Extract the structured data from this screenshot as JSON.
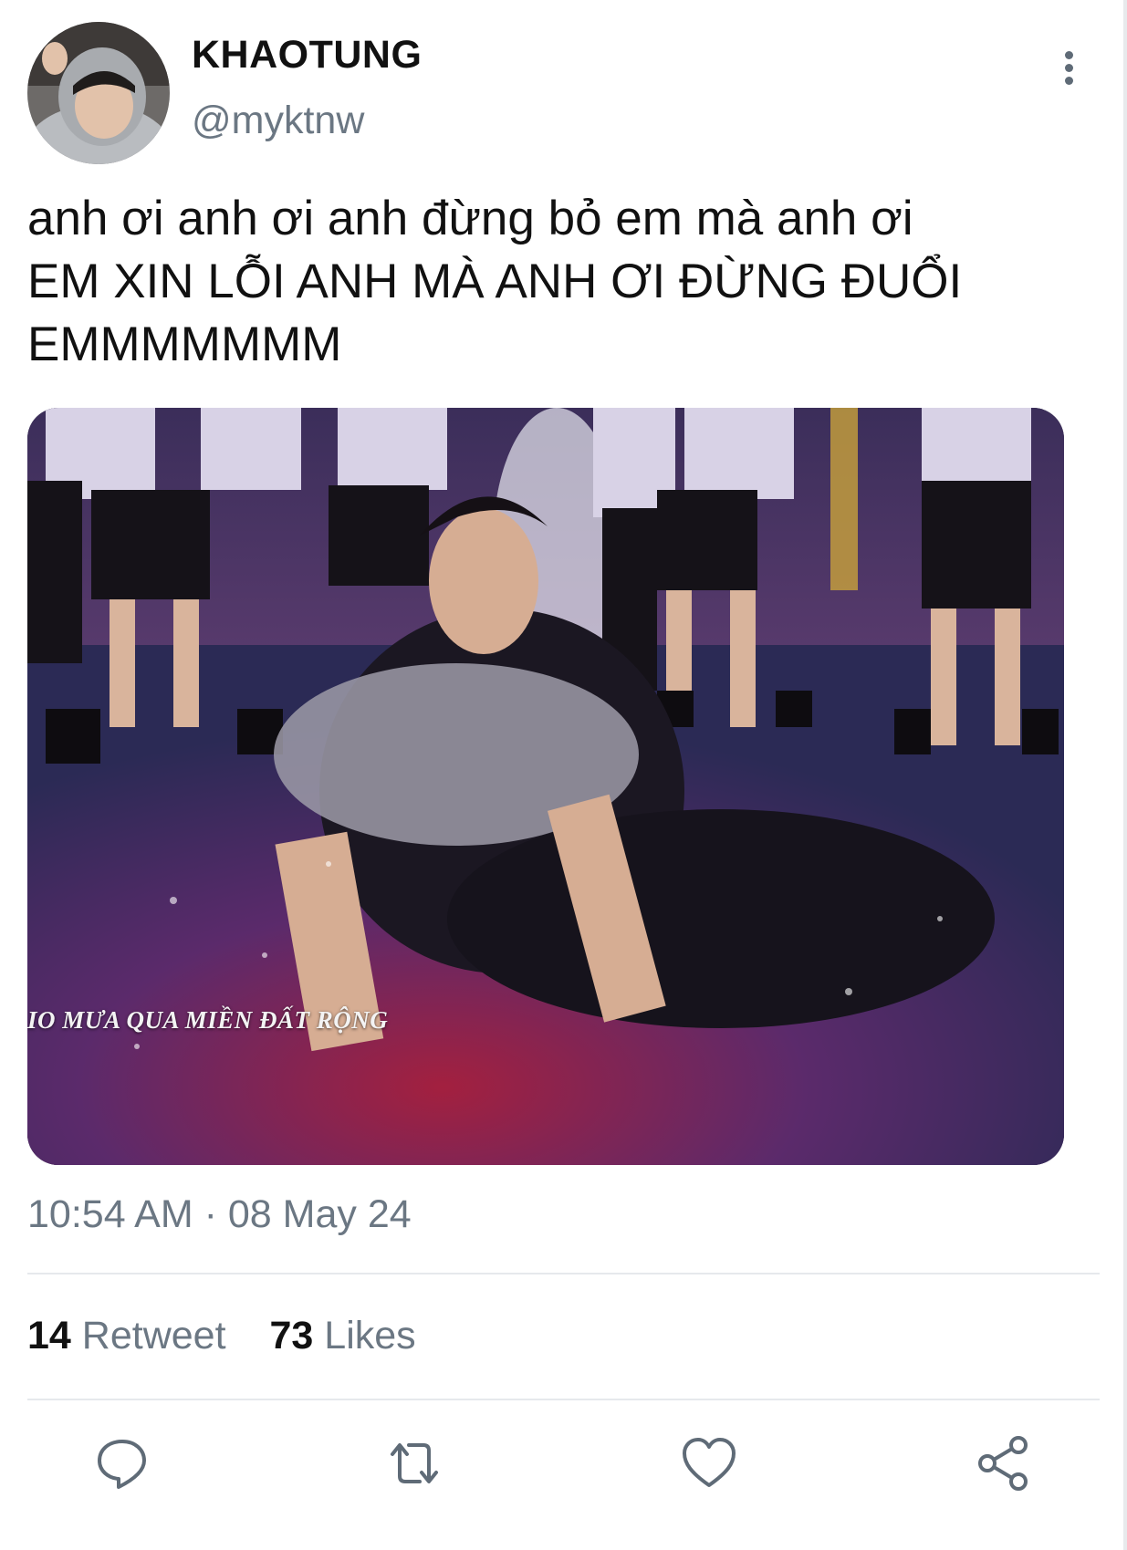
{
  "author": {
    "display_name": "KHAOTUNG",
    "handle": "@myktnw",
    "avatar_icon": "avatar-photo"
  },
  "tweet": {
    "lines": [
      "anh ơi anh ơi anh đừng bỏ em mà anh ơi",
      "EM XIN LỖI ANH MÀ ANH ƠI ĐỪNG ĐUỔI",
      "EMMMMMMM"
    ],
    "media_caption": "IO MƯA QUA MIỀN ĐẤT RỘNG",
    "timestamp": "10:54 AM · 08 May 24"
  },
  "stats": {
    "retweets_count": "14",
    "retweets_label": "Retweet",
    "likes_count": "73",
    "likes_label": "Likes"
  },
  "actions": {
    "reply_icon": "reply-icon",
    "retweet_icon": "retweet-icon",
    "like_icon": "heart-icon",
    "share_icon": "share-icon"
  },
  "colors": {
    "text_primary": "#0f1419",
    "text_secondary": "#6b7783",
    "divider": "#e6e9ec",
    "icon": "#5f6b77"
  }
}
